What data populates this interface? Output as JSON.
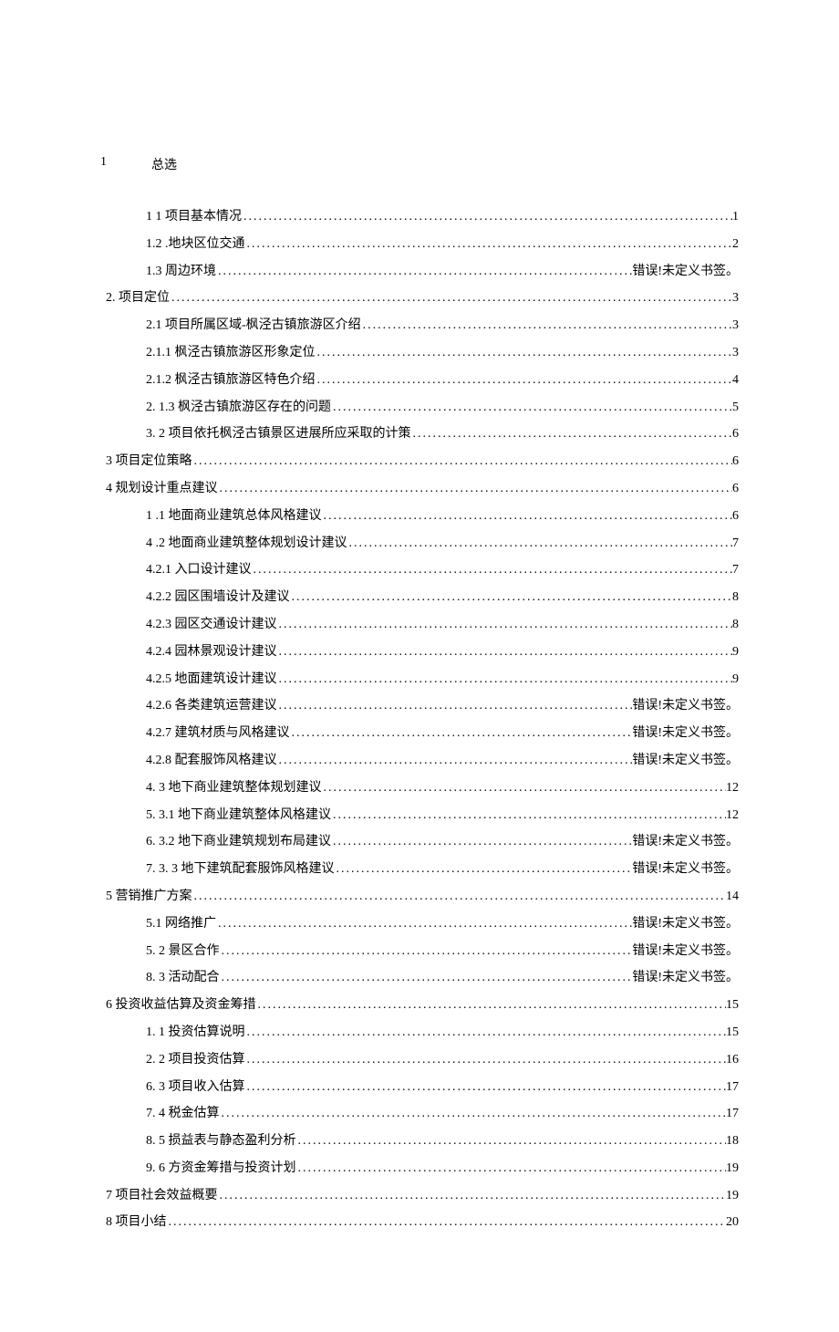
{
  "heading": {
    "num": "1",
    "title": "总选"
  },
  "lines": [
    {
      "lvl": 1,
      "label": "1 1 项目基本情况",
      "page": "1"
    },
    {
      "lvl": 1,
      "label": "1.2  .地块区位交通",
      "page": "2"
    },
    {
      "lvl": 1,
      "label": "1.3  周边环境",
      "page": "错误!未定义书签。"
    },
    {
      "lvl": 0,
      "label": "2.    项目定位",
      "page": "3"
    },
    {
      "lvl": 1,
      "label": "2.1   项目所属区域-枫泾古镇旅游区介绍",
      "page": "3"
    },
    {
      "lvl": 1,
      "label": "2.1.1   枫泾古镇旅游区形象定位",
      "page": "3"
    },
    {
      "lvl": 1,
      "label": "2.1.2   枫泾古镇旅游区特色介绍",
      "page": "4"
    },
    {
      "lvl": 1,
      "label": "2.   1.3 枫泾古镇旅游区存在的问题",
      "page": "5"
    },
    {
      "lvl": 1,
      "label": "3.   2 项目依托枫泾古镇景区进展所应采取的计策",
      "page": "6"
    },
    {
      "lvl": 0,
      "label": "3     项目定位策略",
      "page": "6"
    },
    {
      "lvl": 0,
      "label": "4     规划设计重点建议",
      "page": "6"
    },
    {
      "lvl": 1,
      "label": "1   .1 地面商业建筑总体风格建议",
      "page": "6"
    },
    {
      "lvl": 1,
      "label": "4   .2 地面商业建筑整体规划设计建议",
      "page": "7"
    },
    {
      "lvl": 1,
      "label": "4.2.1 入口设计建议",
      "page": "7"
    },
    {
      "lvl": 1,
      "label": "4.2.2 园区围墙设计及建议",
      "page": "8"
    },
    {
      "lvl": 1,
      "label": "4.2.3 园区交通设计建议",
      "page": "8"
    },
    {
      "lvl": 1,
      "label": "4.2.4 园林景观设计建议",
      "page": "9"
    },
    {
      "lvl": 1,
      "label": "4.2.5 地面建筑设计建议",
      "page": "9"
    },
    {
      "lvl": 1,
      "label": "4.2.6 各类建筑运营建议",
      "page": "错误!未定义书签。"
    },
    {
      "lvl": 1,
      "label": "4.2.7 建筑材质与风格建议",
      "page": "错误!未定义书签。"
    },
    {
      "lvl": 1,
      "label": "4.2.8 配套服饰风格建议",
      "page": "错误!未定义书签。"
    },
    {
      "lvl": 1,
      "label": "4.   3 地下商业建筑整体规划建议",
      "page": "12"
    },
    {
      "lvl": 1,
      "label": "5.   3.1 地下商业建筑整体风格建议",
      "page": "12"
    },
    {
      "lvl": 1,
      "label": "6.   3.2 地下商业建筑规划布局建议",
      "page": "错误!未定义书签。"
    },
    {
      "lvl": 1,
      "label": "7.   3. 3 地下建筑配套服饰风格建议",
      "page": "错误!未定义书签。"
    },
    {
      "lvl": 0,
      "label": "5      营销推广方案",
      "page": "14"
    },
    {
      "lvl": 1,
      "label": "5.1   网络推广",
      "page": "错误!未定义书签。"
    },
    {
      "lvl": 1,
      "label": "5.   2 景区合作",
      "page": "错误!未定义书签。"
    },
    {
      "lvl": 1,
      "label": "8.   3 活动配合",
      "page": "错误!未定义书签。"
    },
    {
      "lvl": 0,
      "label": "6     投资收益估算及资金筹措",
      "page": "15"
    },
    {
      "lvl": 1,
      "label": "1.   1 投资估算说明",
      "page": "15"
    },
    {
      "lvl": 1,
      "label": "2.   2 项目投资估算",
      "page": "16"
    },
    {
      "lvl": 1,
      "label": "6.   3 项目收入估算",
      "page": "17"
    },
    {
      "lvl": 1,
      "label": "7.   4 税金估算",
      "page": "17"
    },
    {
      "lvl": 1,
      "label": "8.   5 损益表与静态盈利分析",
      "page": "18"
    },
    {
      "lvl": 1,
      "label": "9.   6 方资金筹措与投资计划",
      "page": "19"
    },
    {
      "lvl": 0,
      "label": "7     项目社会效益概要",
      "page": "19"
    },
    {
      "lvl": 0,
      "label": "8     项目小结",
      "page": "20"
    }
  ]
}
